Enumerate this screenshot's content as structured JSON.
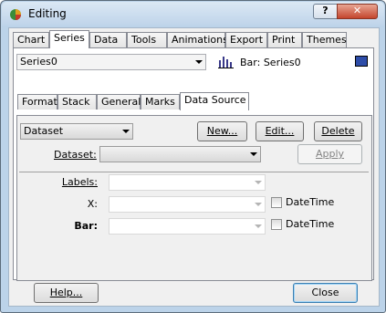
{
  "window": {
    "title": "Editing",
    "help_label": "?",
    "close_label": "✕"
  },
  "tabs": [
    "Chart",
    "Series",
    "Data",
    "Tools",
    "Animations",
    "Export",
    "Print",
    "Themes"
  ],
  "series": {
    "selected": "Series0",
    "type_label": "Bar: Series0",
    "color": "#2e4da8"
  },
  "subtabs": [
    "Format",
    "Stack",
    "General",
    "Marks",
    "Data Source"
  ],
  "datasource": {
    "source": "Dataset",
    "new_label": "New...",
    "edit_label": "Edit...",
    "delete_label": "Delete",
    "dataset_label": "Dataset:",
    "dataset_value": "",
    "apply_label": "Apply",
    "labels_label": "Labels:",
    "x_label": "X:",
    "bar_label": "Bar:",
    "datetime_label": "DateTime"
  },
  "footer": {
    "help_label": "Help...",
    "close_label": "Close"
  }
}
